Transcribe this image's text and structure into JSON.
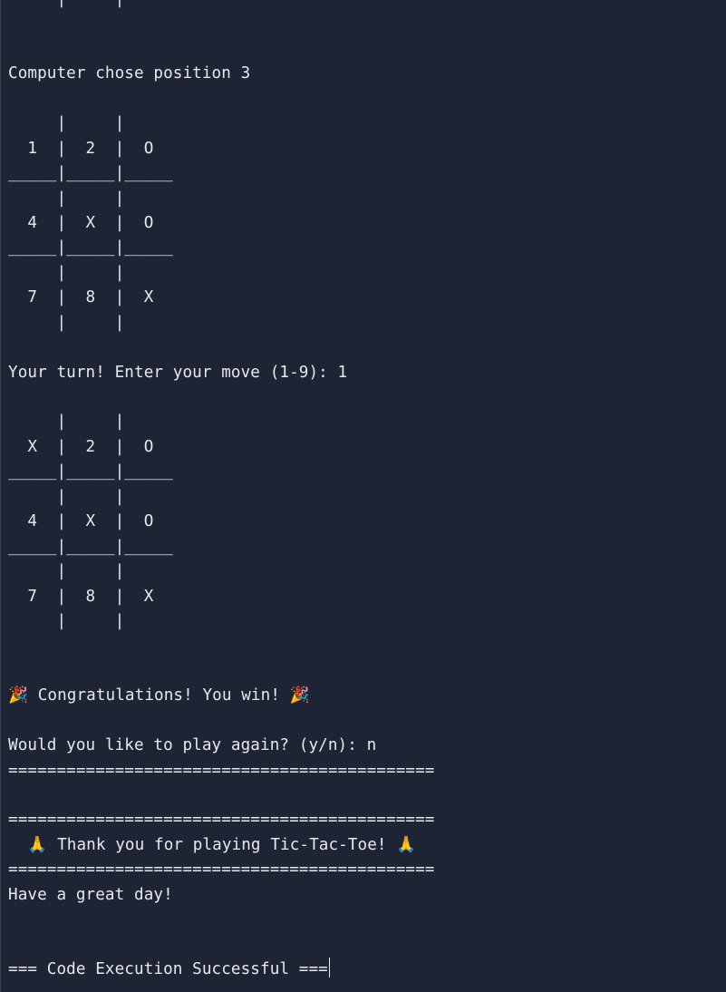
{
  "console": {
    "lines": [
      "     |     |",
      "",
      "",
      "Computer chose position 3",
      "",
      "     |     |",
      "  1  |  2  |  O",
      "_____|_____|_____",
      "     |     |",
      "  4  |  X  |  O",
      "_____|_____|_____",
      "     |     |",
      "  7  |  8  |  X",
      "     |     |",
      "",
      "Your turn! Enter your move (1-9): 1",
      "",
      "     |     |",
      "  X  |  2  |  O",
      "_____|_____|_____",
      "     |     |",
      "  4  |  X  |  O",
      "_____|_____|_____",
      "     |     |",
      "  7  |  8  |  X",
      "     |     |",
      "",
      "",
      "🎉 Congratulations! You win! 🎉",
      "",
      "Would you like to play again? (y/n): n",
      "============================================",
      "",
      "============================================",
      "  🙏 Thank you for playing Tic-Tac-Toe! 🙏",
      "============================================",
      "Have a great day!",
      "",
      "",
      "=== Code Execution Successful ==="
    ]
  }
}
